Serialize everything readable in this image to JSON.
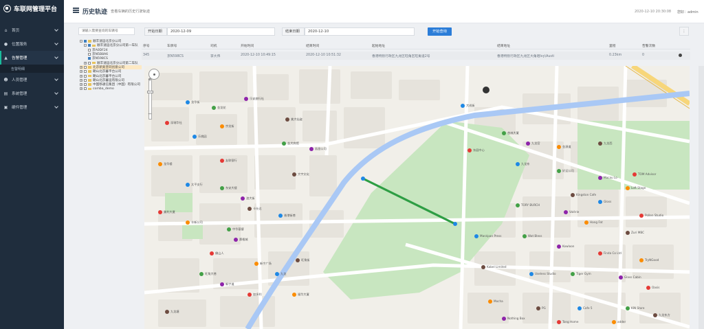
{
  "app": {
    "title": "车联网管理平台",
    "header_time": "2020-12-10 20:30:08",
    "user_greeting": "您好：admin"
  },
  "page": {
    "title": "历史轨迹",
    "subtitle": "查看车辆的历史行驶轨迹"
  },
  "sidebar": {
    "items": [
      {
        "label": "首页",
        "icon": "home-icon"
      },
      {
        "label": "位置服务",
        "icon": "location-icon"
      },
      {
        "label": "告警管理",
        "icon": "warning-icon",
        "active": true
      },
      {
        "label": "人员管理",
        "icon": "user-icon"
      },
      {
        "label": "系统管理",
        "icon": "system-icon"
      },
      {
        "label": "硬件管理",
        "icon": "hardware-icon"
      }
    ],
    "sub_item": "告警明细"
  },
  "tree": {
    "search_placeholder": "请输入需要查询的车辆号",
    "nodes": [
      {
        "label": "顺丰速运北京分公司",
        "level": 0,
        "toggle": "-",
        "checked": true
      },
      {
        "label": "顺丰速运北京分公司第一车队",
        "level": 1,
        "toggle": "-",
        "checked": true
      },
      {
        "label": "京A0DF24",
        "level": 2,
        "checked": false
      },
      {
        "label": "京N5B8A6",
        "level": 2,
        "checked": false
      },
      {
        "label": "京N598CS",
        "level": 2,
        "checked": true
      },
      {
        "label": "顺丰速运北京分公司第二车队",
        "level": 1,
        "toggle": "+",
        "checked": false
      },
      {
        "label": "北京新奥普同创意公司",
        "level": 0,
        "toggle": "+",
        "checked": false,
        "selected": true
      },
      {
        "label": "朝山北京暮平台公司",
        "level": 0,
        "toggle": "+",
        "checked": false
      },
      {
        "label": "朝山北京暮平台公司",
        "level": 0,
        "toggle": "+",
        "checked": false
      },
      {
        "label": "朝山北京暮运有限公司",
        "level": 0,
        "toggle": "+",
        "checked": false
      },
      {
        "label": "中国移通信集团（中国）有限公司",
        "level": 0,
        "toggle": "+",
        "checked": false
      },
      {
        "label": "comba_demo",
        "level": 0,
        "toggle": "+",
        "checked": false
      }
    ]
  },
  "toolbar": {
    "start_label": "开始日期",
    "start_value": "2020-12-09",
    "end_label": "结束日期",
    "end_value": "2020-12-10",
    "query_label": "开始查询",
    "menu_icon": "column-menu-icon"
  },
  "table": {
    "headers": [
      "序号",
      "车牌号",
      "司机",
      "开始时间",
      "结束时间",
      "起始地址",
      "结束地址",
      "里程",
      "告警次数",
      ""
    ],
    "row": [
      "345",
      "京N598CS",
      "李大伟",
      "2020-12-10 10:49:15",
      "2020-12-10 10:51:32",
      "香港特别行政区九龙区旺角区旺角道2号",
      "香港特别行政区九龙区大角咀Ivy\\Austi",
      "0.23km",
      "0",
      ""
    ]
  },
  "map": {
    "colors": {
      "land": "#f1efe9",
      "block": "#e6e3dc",
      "road": "#ffffff",
      "water": "#a9c8f5",
      "park": "#c8e6c0",
      "track": "#2e9e44",
      "highway": "#f7d67a"
    },
    "labels": [
      "龙华街",
      "金龙花",
      "乐安旅行社",
      "深瑞华社",
      "宗龙街",
      "美大仙姿",
      "乐桃园",
      "金大宾馆",
      "丽昌公司",
      "友联银行",
      "龙华楼",
      "大宇文化",
      "太平支行",
      "东安大楼",
      "渣大街",
      "美利大夏",
      "丰新公司",
      "卡仕达",
      "香港街巷",
      "中华基督",
      "赛格城",
      "佛山人",
      "新宁广场",
      "旺角街",
      "九龙",
      "旺角大巷",
      "新宁道",
      "加多利",
      "福华大厦",
      "九龙塘",
      "大成街",
      "杏林大厦",
      "九龙官",
      "东园中心",
      "金源道",
      "九龙西",
      "九龙东",
      "好运公司",
      "Macau Lo",
      "TOM Advisor",
      "Loft Stage",
      "Kingston Cafe",
      "Gloss",
      "TORY BURCH",
      "Valérie",
      "Pollen Studio",
      "Hang Fat",
      "Zuri MBC",
      "Marzipan Press",
      "Wat Bless",
      "Kowloon",
      "Finda Co Ltd",
      "TryNGood",
      "Kabel Limited",
      "Useless Studio",
      "Tiger Gym",
      "Glass Cabin",
      "Oasis",
      "Mocha",
      "PG",
      "Cafe 5",
      "KIN Store",
      "Nothing Box",
      "Tong Home",
      "adder",
      "九龙东方"
    ]
  }
}
